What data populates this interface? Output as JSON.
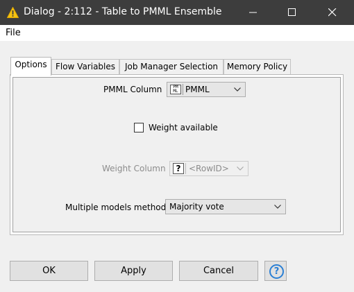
{
  "window": {
    "title": "Dialog - 2:112 - Table to PMML Ensemble",
    "icon": "knime-warning-triangle-icon"
  },
  "menu": {
    "file": "File"
  },
  "tabs": [
    {
      "label": "Options",
      "active": true
    },
    {
      "label": "Flow Variables",
      "active": false
    },
    {
      "label": "Job Manager Selection",
      "active": false
    },
    {
      "label": "Memory Policy",
      "active": false
    }
  ],
  "options": {
    "pmml_column_label": "PMML Column",
    "pmml_column_value": "PMML",
    "pmml_type_glyph": "PM\nML",
    "weight_checkbox_label": "Weight available",
    "weight_checkbox_checked": false,
    "weight_column_label": "Weight Column",
    "weight_column_value": "<RowID>",
    "weight_type_glyph": "?",
    "multiple_models_label": "Multiple models method",
    "multiple_models_value": "Majority vote"
  },
  "buttons": {
    "ok": "OK",
    "apply": "Apply",
    "cancel": "Cancel",
    "help": "?"
  },
  "colors": {
    "titlebar": "#3d3d3d",
    "help_accent": "#2a7fd4"
  }
}
